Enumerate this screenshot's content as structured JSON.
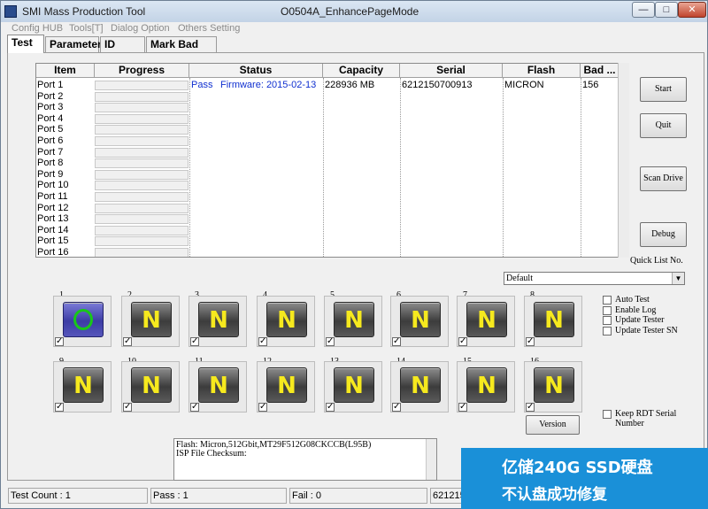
{
  "window": {
    "app_title": "SMI Mass Production Tool",
    "mode_title": "O0504A_EnhancePageMode",
    "min_label": "—",
    "max_label": "□",
    "close_label": "✕"
  },
  "menu": [
    "Config HUB",
    "Tools[T]",
    "Dialog Option",
    "Others Setting"
  ],
  "tabs": [
    "Test",
    "Parameter",
    "ID Table",
    "Mark Bad Info"
  ],
  "grid": {
    "headers": [
      "Item",
      "Progress",
      "Status",
      "Capacity",
      "Serial",
      "Flash",
      "Bad ..."
    ],
    "ports": [
      "Port 1",
      "Port 2",
      "Port 3",
      "Port 4",
      "Port 5",
      "Port 6",
      "Port 7",
      "Port 8",
      "Port 9",
      "Port 10",
      "Port 11",
      "Port 12",
      "Port 13",
      "Port 14",
      "Port 15",
      "Port 16"
    ],
    "row1": {
      "status": "Pass",
      "firmware": "Firmware: 2015-02-13",
      "capacity": "228936 MB",
      "serial": "6212150700913",
      "flash": "MICRON",
      "bad": "156"
    }
  },
  "buttons": {
    "start": "Start",
    "quit": "Quit",
    "scan_drive": "Scan Drive",
    "debug": "Debug",
    "version": "Version"
  },
  "quick_list": {
    "label": "Quick List No.",
    "value": "Default"
  },
  "options": [
    "Auto Test",
    "Enable Log",
    "Update Tester",
    "Update Tester SN"
  ],
  "keep_rdt": "Keep RDT Serial Number",
  "slots": {
    "numbers": [
      "1",
      "2",
      "3",
      "4",
      "5",
      "6",
      "7",
      "8",
      "9",
      "10",
      "11",
      "12",
      "13",
      "14",
      "15",
      "16"
    ],
    "n_glyph": "N"
  },
  "log_lines": [
    "Flash: Micron,512Gbit,MT29F512G08CKCCB(L95B)",
    "ISP File Checksum:"
  ],
  "status": {
    "test_count": "Test Count : 1",
    "pass": "Pass : 1",
    "fail": "Fail : 0",
    "serial_partial": "621215"
  },
  "watermark": {
    "line1": "亿储240G SSD硬盘",
    "line2": "不认盘成功修复"
  }
}
